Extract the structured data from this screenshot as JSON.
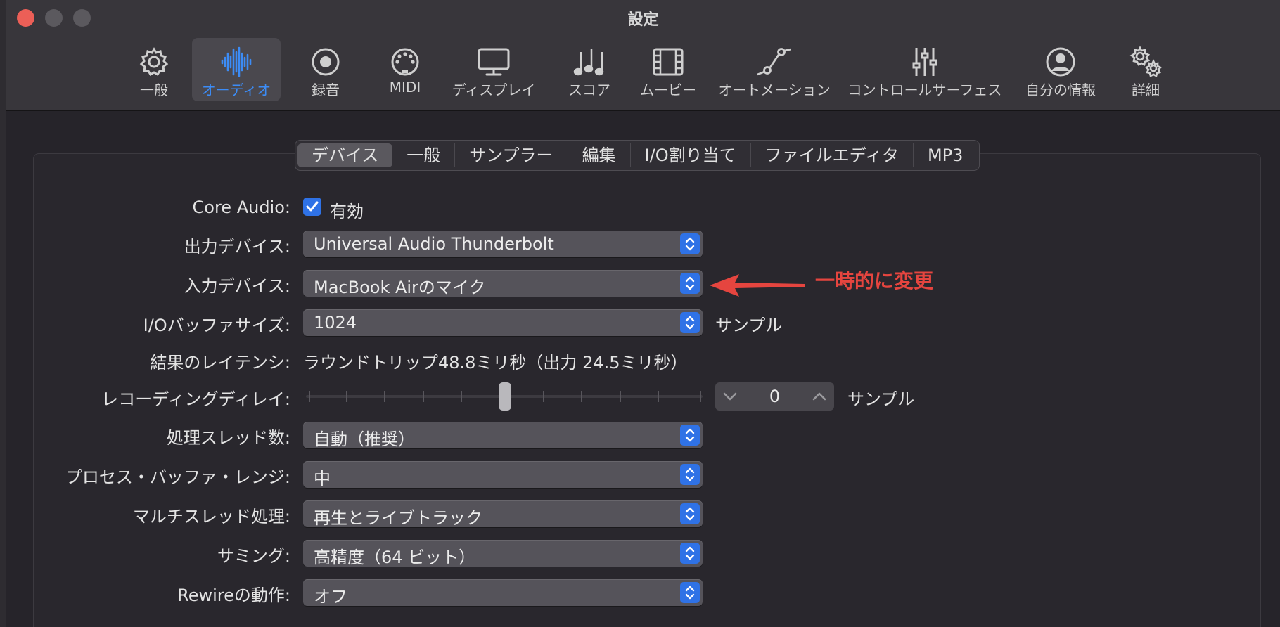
{
  "window": {
    "title": "設定"
  },
  "toolbar": {
    "items": [
      {
        "label": "一般",
        "icon": "gear-icon"
      },
      {
        "label": "オーディオ",
        "icon": "waveform-icon",
        "active": true
      },
      {
        "label": "録音",
        "icon": "record-icon"
      },
      {
        "label": "MIDI",
        "icon": "midi-port-icon"
      },
      {
        "label": "ディスプレイ",
        "icon": "display-icon"
      },
      {
        "label": "スコア",
        "icon": "music-notes-icon"
      },
      {
        "label": "ムービー",
        "icon": "film-icon"
      },
      {
        "label": "オートメーション",
        "icon": "automation-icon"
      },
      {
        "label": "コントロールサーフェス",
        "icon": "sliders-icon"
      },
      {
        "label": "自分の情報",
        "icon": "person-icon"
      },
      {
        "label": "詳細",
        "icon": "gears-icon"
      }
    ]
  },
  "tabs": [
    {
      "label": "デバイス",
      "selected": true
    },
    {
      "label": "一般"
    },
    {
      "label": "サンプラー"
    },
    {
      "label": "編集"
    },
    {
      "label": "I/O割り当て"
    },
    {
      "label": "ファイルエディタ"
    },
    {
      "label": "MP3"
    }
  ],
  "form": {
    "core_audio": {
      "label": "Core Audio:",
      "checkbox_label": "有効",
      "checked": true
    },
    "output_device": {
      "label": "出力デバイス:",
      "value": "Universal Audio Thunderbolt"
    },
    "input_device": {
      "label": "入力デバイス:",
      "value": "MacBook Airのマイク"
    },
    "buffer_size": {
      "label": "I/Oバッファサイズ:",
      "value": "1024",
      "unit": "サンプル"
    },
    "latency": {
      "label": "結果のレイテンシ:",
      "value": "ラウンドトリップ48.8ミリ秒（出力 24.5ミリ秒）"
    },
    "recording_delay": {
      "label": "レコーディングディレイ:",
      "value": "0",
      "unit": "サンプル",
      "slider_position": 0.5
    },
    "threads": {
      "label": "処理スレッド数:",
      "value": "自動（推奨）"
    },
    "buffer_range": {
      "label": "プロセス・バッファ・レンジ:",
      "value": "中"
    },
    "multithreading": {
      "label": "マルチスレッド処理:",
      "value": "再生とライブトラック"
    },
    "summing": {
      "label": "サミング:",
      "value": "高精度（64 ビット）"
    },
    "rewire": {
      "label": "Rewireの動作:",
      "value": "オフ"
    }
  },
  "annotation": {
    "text": "一時的に変更",
    "color": "#e5453f"
  },
  "colors": {
    "accent": "#2f72e6",
    "active_label": "#3c8cf6"
  }
}
